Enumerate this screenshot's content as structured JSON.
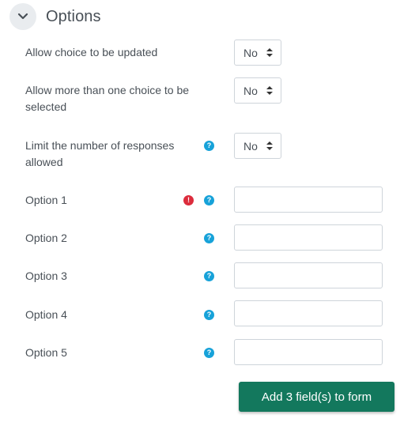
{
  "section": {
    "title": "Options",
    "toggle_icon": "chevron-down-icon"
  },
  "fields": {
    "allow_update": {
      "label": "Allow choice to be updated",
      "value": "No"
    },
    "allow_multiple": {
      "label": "Allow more than one choice to be selected",
      "value": "No"
    },
    "limit_responses": {
      "label": "Limit the number of responses allowed",
      "value": "No",
      "help_icon": "help-icon"
    },
    "options": [
      {
        "label": "Option 1",
        "value": "",
        "required": true
      },
      {
        "label": "Option 2",
        "value": ""
      },
      {
        "label": "Option 3",
        "value": ""
      },
      {
        "label": "Option 4",
        "value": ""
      },
      {
        "label": "Option 5",
        "value": ""
      }
    ]
  },
  "icons": {
    "help_glyph": "?",
    "required_glyph": "!"
  },
  "add_button": {
    "label": "Add 3 field(s) to form"
  },
  "colors": {
    "primary": "#13785d",
    "help": "#17a2d9",
    "required": "#dc2c3c"
  }
}
